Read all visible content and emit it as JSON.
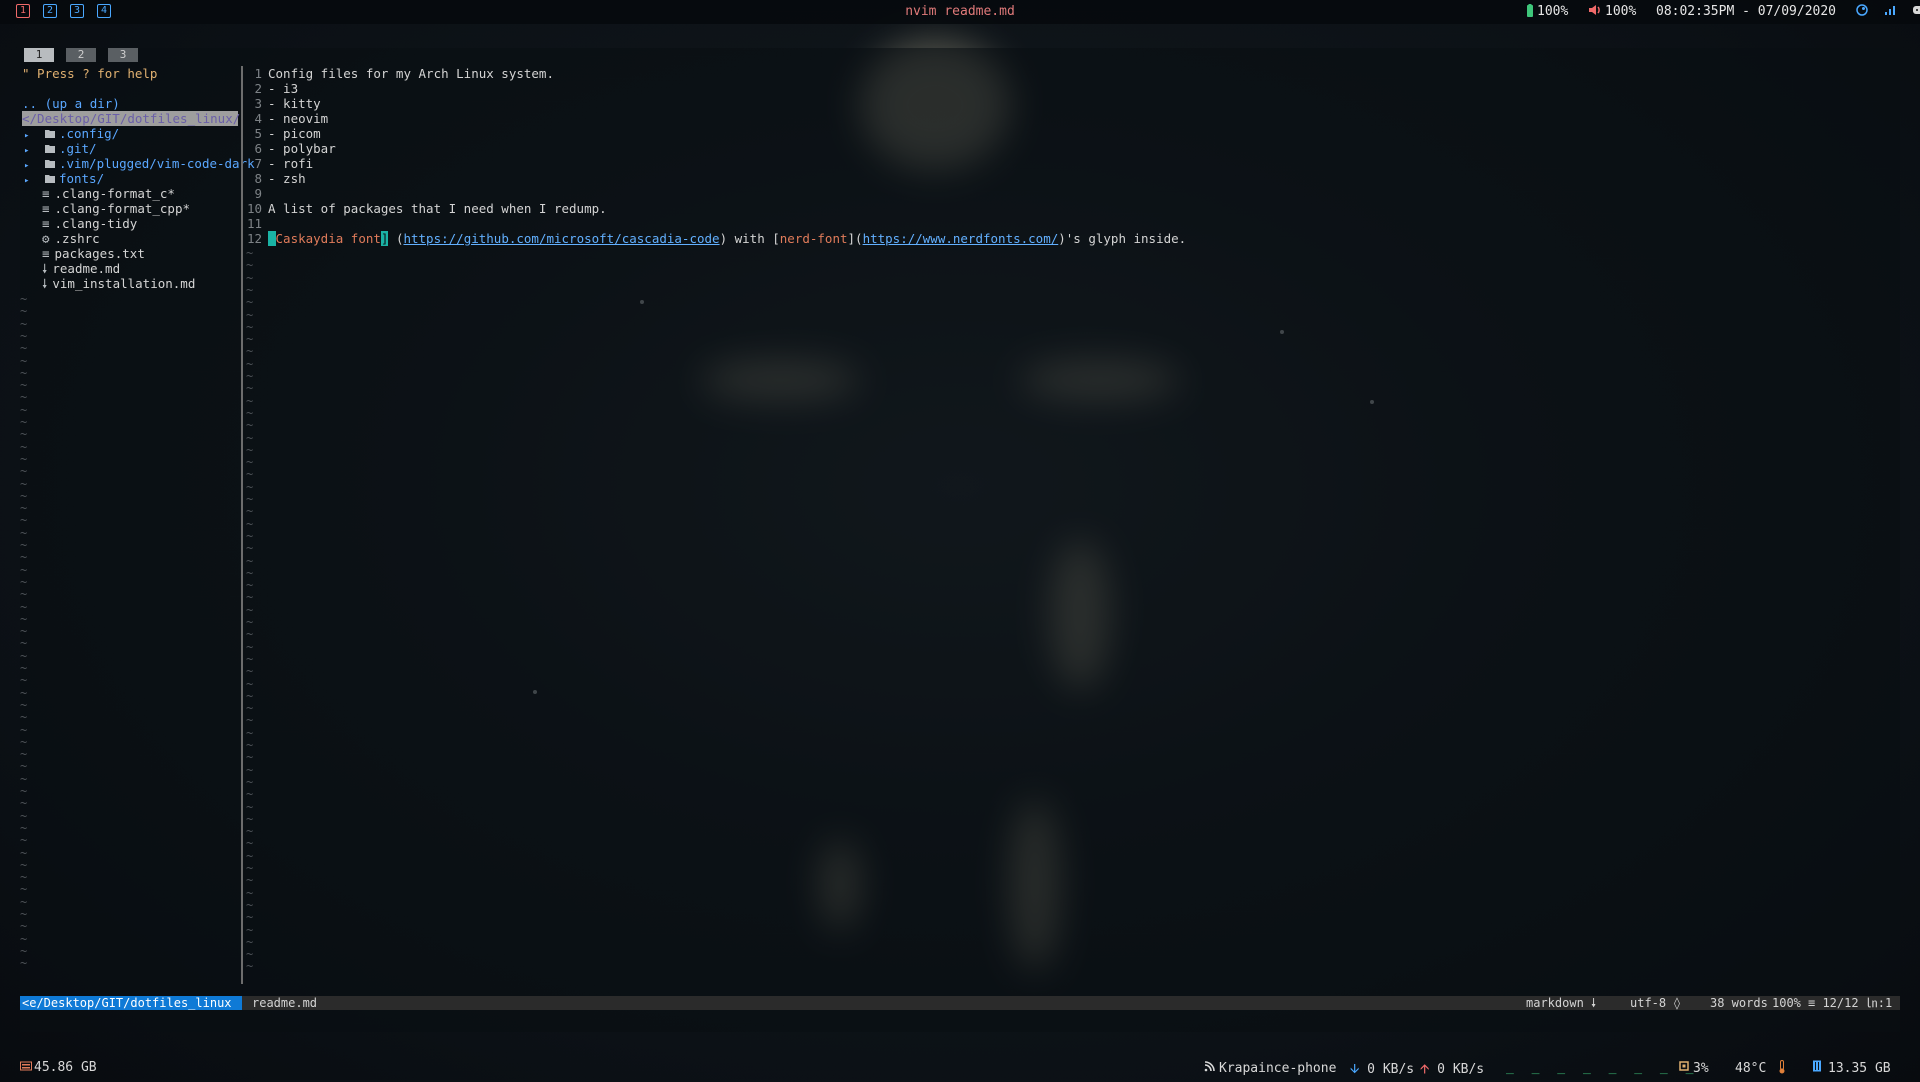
{
  "colors": {
    "accent_blue": "#4aa8ff",
    "accent_red": "#f06a6a",
    "tree_dir": "#5aa7ff",
    "tree_help": "#e0b070",
    "selection_bg": "#9e9e9e",
    "status_path_bg": "#0f7ad6",
    "md_link_text": "#e07b5a",
    "md_url": "#62b0ff",
    "md_cursor": "#1ab3a5",
    "bottom_green": "#3ec67a"
  },
  "top_bar": {
    "workspaces": [
      "1",
      "2",
      "3",
      "4"
    ],
    "active_workspace": "1",
    "window_title": "nvim readme.md",
    "battery": "100%",
    "volume": "100%",
    "datetime": "08:02:35PM - 07/09/2020"
  },
  "terminal": {
    "tabs": [
      "1",
      "2",
      "3"
    ],
    "active_tab": "1"
  },
  "nerdtree": {
    "help_line": "\" Press ? for help",
    "up_dir": ".. (up a dir)",
    "current_path": "</Desktop/GIT/dotfiles_linux/",
    "entries": [
      {
        "name": ".config/",
        "type": "dir"
      },
      {
        "name": ".git/",
        "type": "dir"
      },
      {
        "name": ".vim/plugged/vim-code-dark",
        "type": "dir"
      },
      {
        "name": "fonts/",
        "type": "dir"
      },
      {
        "name": ".clang-format_c*",
        "type": "file"
      },
      {
        "name": ".clang-format_cpp*",
        "type": "file"
      },
      {
        "name": ".clang-tidy",
        "type": "file"
      },
      {
        "name": ".zshrc",
        "type": "config"
      },
      {
        "name": "packages.txt",
        "type": "file"
      },
      {
        "name": "readme.md",
        "type": "markdown"
      },
      {
        "name": "vim_installation.md",
        "type": "markdown"
      }
    ]
  },
  "editor": {
    "lines": [
      {
        "n": "1",
        "text": "Config files for my Arch Linux system."
      },
      {
        "n": "2",
        "text": "- i3"
      },
      {
        "n": "3",
        "text": "- kitty"
      },
      {
        "n": "4",
        "text": "- neovim"
      },
      {
        "n": "5",
        "text": "- picom"
      },
      {
        "n": "6",
        "text": "- polybar"
      },
      {
        "n": "7",
        "text": "- rofi"
      },
      {
        "n": "8",
        "text": "- zsh"
      },
      {
        "n": "9",
        "text": ""
      },
      {
        "n": "10",
        "text": "A list of packages that I need when I redump."
      },
      {
        "n": "11",
        "text": ""
      }
    ],
    "line12": {
      "n": "12",
      "link1_text": "Caskaydia font",
      "link1_url": "https://github.com/microsoft/cascadia-code",
      "mid": " with [",
      "link2_text": "nerd-font",
      "link2_url": "https://www.nerdfonts.com/",
      "tail": ")'s glyph inside."
    }
  },
  "statusline": {
    "path": "<e/Desktop/GIT/dotfiles_linux",
    "file": "readme.md",
    "filetype": "markdown",
    "encoding": "utf-8",
    "words": "38 words",
    "percent": "100%",
    "position": "12/12 ㏑:1"
  },
  "bottom_bar": {
    "disk": "45.86 GB",
    "wifi": "Krapaince-phone",
    "down": "0 KB/s",
    "up": "0 KB/s",
    "cpu": "3%",
    "temp": "48°C",
    "mem": "13.35 GB"
  }
}
